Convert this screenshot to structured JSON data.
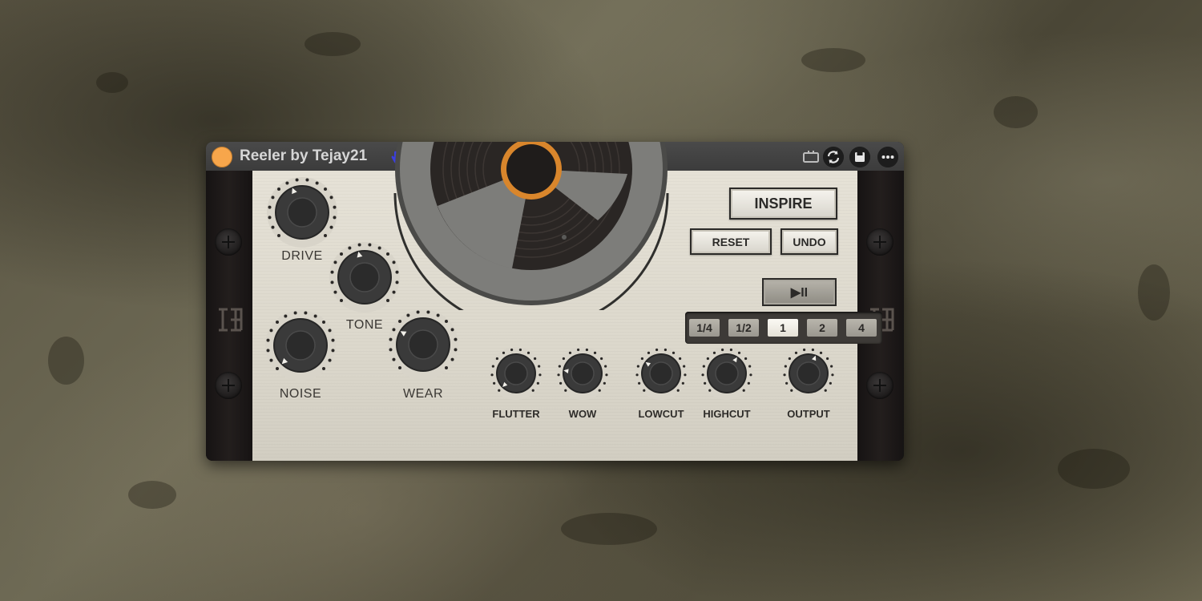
{
  "window": {
    "title": "Reeler by Tejay21",
    "icons": [
      "power-led",
      "hand-icon",
      "midi-icon",
      "sync-icon",
      "save-icon",
      "more-icon"
    ]
  },
  "knobs_large": [
    {
      "id": "drive",
      "label": "DRIVE",
      "value": 0.42
    },
    {
      "id": "tone",
      "label": "TONE",
      "value": 0.45
    },
    {
      "id": "noise",
      "label": "NOISE",
      "value": 0.0
    },
    {
      "id": "wear",
      "label": "WEAR",
      "value": 0.28
    }
  ],
  "knobs_small": [
    {
      "id": "flutter",
      "label": "FLUTTER",
      "value": 0.0
    },
    {
      "id": "wow",
      "label": "WOW",
      "value": 0.2
    },
    {
      "id": "lowcut",
      "label": "LOWCUT",
      "value": 0.3
    },
    {
      "id": "highcut",
      "label": "HIGHCUT",
      "value": 0.62
    },
    {
      "id": "output",
      "label": "OUTPUT",
      "value": 0.58
    }
  ],
  "buttons": {
    "inspire": "INSPIRE",
    "reset": "RESET",
    "undo": "UNDO",
    "play_pause": "▶II"
  },
  "rates": {
    "options": [
      "1/4",
      "1/2",
      "1",
      "2",
      "4"
    ],
    "selected": "1"
  },
  "colors": {
    "accent": "#f7a64b",
    "panel": "#e2ded3",
    "knob": "#2e2e2e",
    "reel_hub": "#e0892e"
  }
}
